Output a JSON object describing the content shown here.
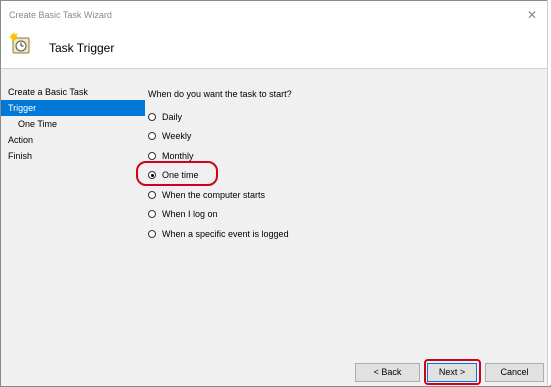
{
  "window": {
    "title": "Create Basic Task Wizard",
    "close_glyph": "✕"
  },
  "header": {
    "icon": "clock-task-icon",
    "title": "Task Trigger"
  },
  "sidebar": {
    "items": [
      {
        "label": "Create a Basic Task",
        "selected": false,
        "sub": false
      },
      {
        "label": "Trigger",
        "selected": true,
        "sub": false
      },
      {
        "label": "One Time",
        "selected": false,
        "sub": true
      },
      {
        "label": "Action",
        "selected": false,
        "sub": false
      },
      {
        "label": "Finish",
        "selected": false,
        "sub": false
      }
    ]
  },
  "main": {
    "question": "When do you want the task to start?",
    "options": [
      {
        "label": "Daily",
        "checked": false
      },
      {
        "label": "Weekly",
        "checked": false
      },
      {
        "label": "Monthly",
        "checked": false
      },
      {
        "label": "One time",
        "checked": true
      },
      {
        "label": "When the computer starts",
        "checked": false
      },
      {
        "label": "When I log on",
        "checked": false
      },
      {
        "label": "When a specific event is logged",
        "checked": false
      }
    ]
  },
  "buttons": {
    "back": "< Back",
    "next": "Next >",
    "cancel": "Cancel"
  },
  "colors": {
    "selection": "#0078d7",
    "annotation": "#d0021b"
  }
}
